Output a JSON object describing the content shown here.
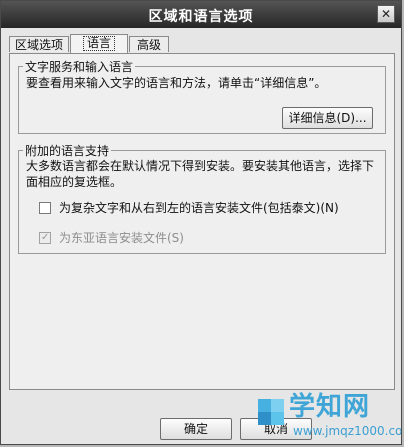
{
  "window": {
    "title": "区域和语言选项",
    "close_label": "✕"
  },
  "tabs": [
    {
      "label": "区域选项",
      "active": false
    },
    {
      "label": "语言",
      "active": true
    },
    {
      "label": "高级",
      "active": false
    }
  ],
  "text_services": {
    "group_title": "文字服务和输入语言",
    "description": "要查看用来输入文字的语言和方法，请单击“详细信息”。",
    "details_button": "详细信息(D)..."
  },
  "supplemental": {
    "group_title": "附加的语言支持",
    "description": "大多数语言都会在默认情况下得到安装。要安装其他语言，选择下面相应的复选框。",
    "complex_script_checkbox": {
      "label": "为复杂文字和从右到左的语言安装文件(包括泰文)(N)",
      "checked": false
    },
    "east_asian_checkbox": {
      "label": "为东亚语言安装文件(S)",
      "checked": true,
      "disabled": true
    }
  },
  "footer": {
    "ok_label": "确定",
    "cancel_label": "取消"
  },
  "watermark": {
    "site": "学知网",
    "url": "www.jmqz1000.com"
  }
}
